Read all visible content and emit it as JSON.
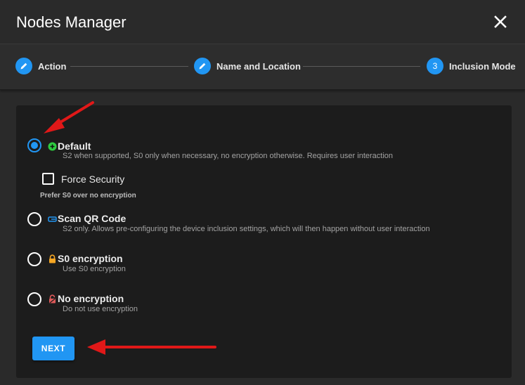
{
  "window": {
    "title": "Nodes Manager"
  },
  "header": {
    "close_icon": "close-icon"
  },
  "stepper": {
    "steps": [
      {
        "label": "Action",
        "icon": "pencil-icon"
      },
      {
        "label": "Name and Location",
        "icon": "pencil-icon"
      },
      {
        "label": "Inclusion Mode",
        "number": "3"
      }
    ]
  },
  "options": [
    {
      "title": "Default",
      "desc": "S2 when supported, S0 only when necessary, no encryption otherwise. Requires user interaction",
      "icon": "plus-circle-icon",
      "selected": true
    },
    {
      "title": "Scan QR Code",
      "desc": "S2 only. Allows pre-configuring the device inclusion settings, which will then happen without user interaction",
      "icon": "qr-link-icon",
      "selected": false
    },
    {
      "title": "S0 encryption",
      "desc": "Use S0 encryption",
      "icon": "lock-icon",
      "selected": false
    },
    {
      "title": "No encryption",
      "desc": "Do not use encryption",
      "icon": "unlocked-icon",
      "selected": false
    }
  ],
  "force_security": {
    "label": "Force Security",
    "help": "Prefer S0 over no encryption",
    "checked": false
  },
  "actions": {
    "next_label": "NEXT"
  },
  "colors": {
    "accent": "#2196f3",
    "annotation_arrow": "#e01818",
    "add_green": "#2ecc40",
    "lock_orange": "#f5a623",
    "unlock_red": "#e05a5a"
  }
}
